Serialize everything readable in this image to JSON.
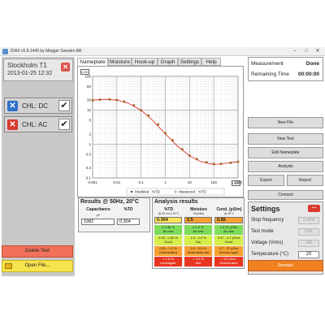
{
  "window": {
    "title": "IDAX v5.8.1445 by Megger Sweden AB",
    "controls": [
      "–",
      "□",
      "✕"
    ]
  },
  "left_panel": {
    "location": "Stockholm T1",
    "date": "2013-01-25 12:32",
    "channels": [
      {
        "label": "CHL: DC",
        "color": "#2f6fc8",
        "checked": "✔"
      },
      {
        "label": "CHL: AC",
        "color": "#d9392e",
        "checked": "✔"
      }
    ],
    "delete_label": "Delete Test",
    "open_label": "Open File..."
  },
  "tabs": [
    "Nameplate",
    "Moisture",
    "Hook-up",
    "Graph",
    "Settings",
    "Help"
  ],
  "plot": {
    "log_y": "LOG",
    "log_x": "LOG",
    "legend_modeled": "Modeled : %TD",
    "legend_measured": "Measured : %TD"
  },
  "chart_data": {
    "type": "scatter",
    "x_scale": "log",
    "y_scale": "log",
    "xlim": [
      0.001,
      1000
    ],
    "ylim": [
      0.1,
      100
    ],
    "x_ticks": [
      "0.001",
      "0.01",
      "0.1",
      "1",
      "10",
      "100",
      "1000"
    ],
    "y_ticks": [
      "100",
      "50",
      "20",
      "10",
      "5",
      "2",
      "1",
      "0.5",
      "0.2",
      "0.1"
    ],
    "series": [
      {
        "name": "Modeled : %TD",
        "x": [
          0.001,
          0.003,
          0.01,
          0.03,
          0.1,
          0.3,
          1,
          3,
          10,
          30,
          100,
          300,
          1000
        ],
        "y": [
          20,
          21,
          20,
          16,
          10,
          5,
          2,
          0.9,
          0.45,
          0.3,
          0.25,
          0.27,
          0.3
        ]
      },
      {
        "name": "Measured : %TD",
        "x": [
          0.001,
          0.002,
          0.005,
          0.01,
          0.02,
          0.05,
          0.1,
          0.2,
          0.5,
          1,
          2,
          5,
          10,
          20,
          50,
          100,
          200,
          500,
          1000
        ],
        "y": [
          19.5,
          20.5,
          21,
          20,
          18,
          14,
          10,
          7,
          3.8,
          2.1,
          1.3,
          0.7,
          0.46,
          0.36,
          0.29,
          0.26,
          0.26,
          0.28,
          0.3
        ]
      }
    ]
  },
  "results": {
    "title": "Results @ 50Hz, 20°C",
    "cap_header": "Capacitance",
    "cap_unit": "pF",
    "td_header": "%TD",
    "cap_value": "1982",
    "td_value": "0.304"
  },
  "analysis": {
    "title": "Analysis results",
    "col1": "%TD",
    "col1_sub": "@ 50 Hz & 20°C",
    "col2": "Moisture",
    "col2_sub": "%(cellul)",
    "col3": "Cond. (pS/m)",
    "col3_sub": "@ 20°C",
    "measured": [
      "0.304",
      "2.5",
      "0.56"
    ],
    "rows": [
      [
        "≤ 0.30 %\nAs new",
        "≤ 1.0 %\nAs new",
        "≤ 0.37 pS/m\nAs new"
      ],
      [
        "0.30 - 0.50 %\nGood",
        "1.0 - 2.0 %\nDry",
        "0.37 - 3.7 pS/m\nGood"
      ],
      [
        "0.50 - 1.0 %\nDeteriorated",
        "2.0 - 3.0 %\nModerately wet",
        "3.7 - 37 pS/m\nService aged"
      ],
      [
        "> 1.0 %\nInvestigate",
        "> 3.0 %\nWet",
        "> 37 pS/m\nDeteriorated"
      ]
    ],
    "row_colors": [
      "#7fdc5a",
      "#d6ee4a",
      "#f7a030",
      "#e8351f"
    ],
    "measured_colors": [
      "#ffe25a",
      "#f7a030",
      "#f7a030"
    ]
  },
  "right_panel": {
    "measurement_label": "Measurement",
    "measurement_value": "Done",
    "remaining_label": "Remaining Time",
    "remaining_value": "00:00:00",
    "new_file": "New File",
    "new_test": "New Test",
    "edit_nameplate": "Edit Nameplate",
    "analysis": "Analysis",
    "export": "Export",
    "report": "Report",
    "connect": "Connect",
    "settings": {
      "title": "Settings",
      "menu": "...",
      "stop_freq_label": "Stop frequency",
      "stop_freq_value": "1 mHz",
      "test_mode_label": "Test mode",
      "test_mode_value": "CHL",
      "voltage_label": "Voltage (Vrms)",
      "voltage_value": "140",
      "temp_label": "Temperature (°C)",
      "temp_value": "20"
    },
    "remake": "Remake"
  }
}
